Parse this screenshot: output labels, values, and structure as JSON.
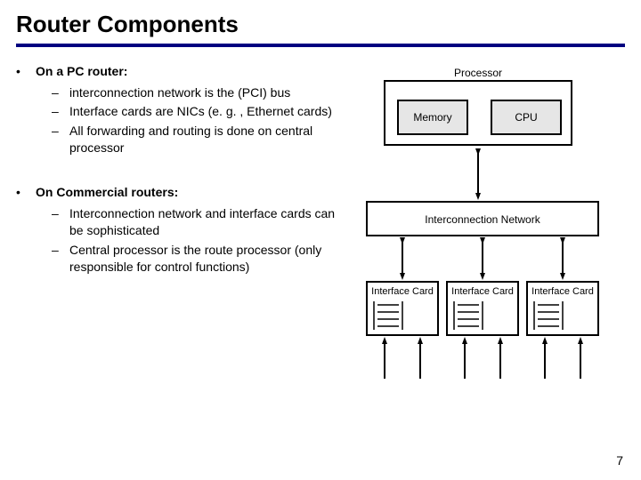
{
  "title": "Router Components",
  "bullets": {
    "g1": {
      "head": "On a PC router:",
      "items": [
        "interconnection network is the (PCI) bus",
        "Interface cards are NICs (e. g. , Ethernet cards)",
        "All forwarding and routing is done on central processor"
      ]
    },
    "g2": {
      "head": "On Commercial routers:",
      "items": [
        "Interconnection network and interface cards can be sophisticated",
        "Central processor is the route processor (only responsible for control functions)"
      ]
    }
  },
  "diagram": {
    "processor_label": "Processor",
    "memory_label": "Memory",
    "cpu_label": "CPU",
    "interconnect_label": "Interconnection Network",
    "ifcard_label": "Interface Card"
  },
  "page_number": "7"
}
